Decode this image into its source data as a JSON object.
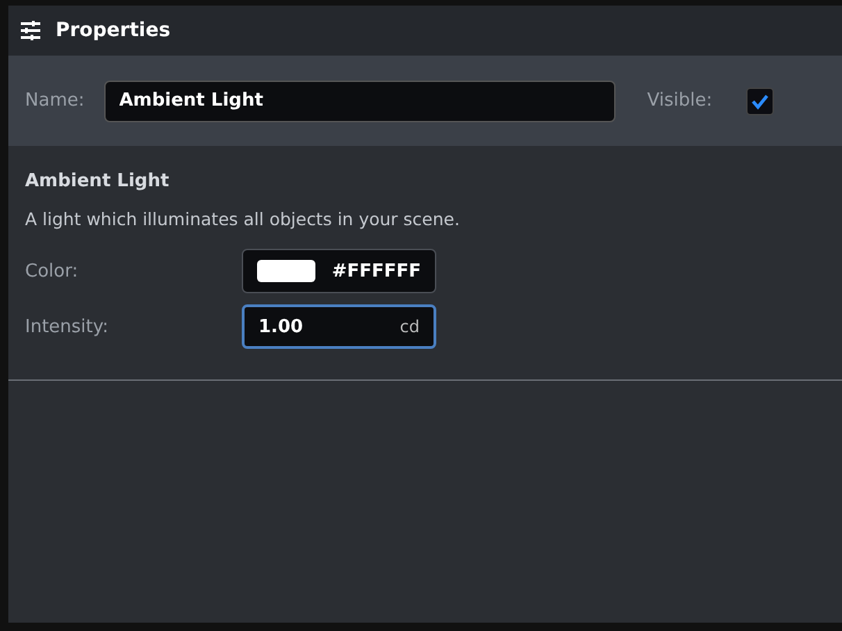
{
  "panel": {
    "title": "Properties"
  },
  "name_row": {
    "label": "Name:",
    "value": "Ambient Light",
    "visible_label": "Visible:",
    "visible": true
  },
  "section": {
    "title": "Ambient Light",
    "description": "A light which illuminates all objects in your scene."
  },
  "fields": [
    {
      "kind": "color",
      "label": "Color:",
      "value": "#FFFFFF",
      "color": "#ffffff",
      "focused": false
    },
    {
      "kind": "number",
      "label": "Intensity:",
      "value": "1.00",
      "unit": "cd",
      "focused": true
    }
  ]
}
